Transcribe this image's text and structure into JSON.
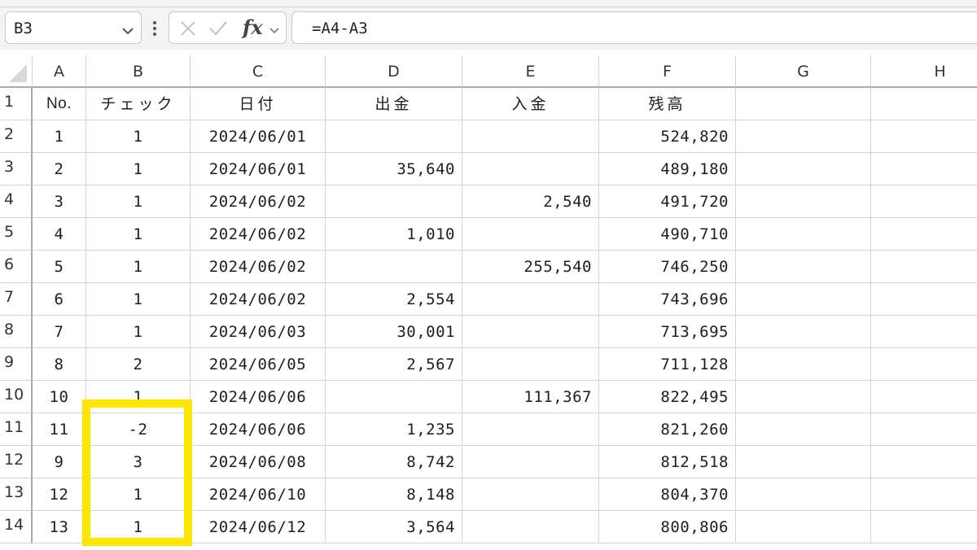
{
  "formula_bar": {
    "name_box": "B3",
    "formula": "=A4-A3",
    "fx_label": "fx"
  },
  "columns": [
    "A",
    "B",
    "C",
    "D",
    "E",
    "F",
    "G",
    "H"
  ],
  "headers": {
    "no": "No.",
    "check": "チェック",
    "date": "日付",
    "withdrawal": "出金",
    "deposit": "入金",
    "balance": "残高"
  },
  "rows": [
    {
      "row": "2",
      "no": "1",
      "check": "1",
      "date": "2024/06/01",
      "withdrawal": "",
      "deposit": "",
      "balance": "524,820"
    },
    {
      "row": "3",
      "no": "2",
      "check": "1",
      "date": "2024/06/01",
      "withdrawal": "35,640",
      "deposit": "",
      "balance": "489,180"
    },
    {
      "row": "4",
      "no": "3",
      "check": "1",
      "date": "2024/06/02",
      "withdrawal": "",
      "deposit": "2,540",
      "balance": "491,720"
    },
    {
      "row": "5",
      "no": "4",
      "check": "1",
      "date": "2024/06/02",
      "withdrawal": "1,010",
      "deposit": "",
      "balance": "490,710"
    },
    {
      "row": "6",
      "no": "5",
      "check": "1",
      "date": "2024/06/02",
      "withdrawal": "",
      "deposit": "255,540",
      "balance": "746,250"
    },
    {
      "row": "7",
      "no": "6",
      "check": "1",
      "date": "2024/06/02",
      "withdrawal": "2,554",
      "deposit": "",
      "balance": "743,696"
    },
    {
      "row": "8",
      "no": "7",
      "check": "1",
      "date": "2024/06/03",
      "withdrawal": "30,001",
      "deposit": "",
      "balance": "713,695"
    },
    {
      "row": "9",
      "no": "8",
      "check": "2",
      "date": "2024/06/05",
      "withdrawal": "2,567",
      "deposit": "",
      "balance": "711,128"
    },
    {
      "row": "10",
      "no": "10",
      "check": "1",
      "date": "2024/06/06",
      "withdrawal": "",
      "deposit": "111,367",
      "balance": "822,495"
    },
    {
      "row": "11",
      "no": "11",
      "check": "-2",
      "date": "2024/06/06",
      "withdrawal": "1,235",
      "deposit": "",
      "balance": "821,260"
    },
    {
      "row": "12",
      "no": "9",
      "check": "3",
      "date": "2024/06/08",
      "withdrawal": "8,742",
      "deposit": "",
      "balance": "812,518"
    },
    {
      "row": "13",
      "no": "12",
      "check": "1",
      "date": "2024/06/10",
      "withdrawal": "8,148",
      "deposit": "",
      "balance": "804,370"
    },
    {
      "row": "14",
      "no": "13",
      "check": "1",
      "date": "2024/06/12",
      "withdrawal": "3,564",
      "deposit": "",
      "balance": "800,806"
    }
  ],
  "highlight_color": "#ffe600"
}
